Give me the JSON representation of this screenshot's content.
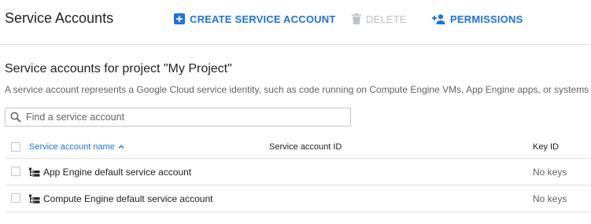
{
  "header": {
    "title": "Service Accounts",
    "create_label": "CREATE SERVICE ACCOUNT",
    "delete_label": "DELETE",
    "permissions_label": "PERMISSIONS"
  },
  "section": {
    "title": "Service accounts for project \"My Project\"",
    "description": "A service account represents a Google Cloud service identity, such as code running on Compute Engine VMs, App Engine apps, or systems"
  },
  "search": {
    "placeholder": "Find a service account",
    "value": ""
  },
  "table": {
    "columns": {
      "name": "Service account name",
      "id": "Service account ID",
      "key": "Key ID"
    },
    "sort": "ascending",
    "rows": [
      {
        "name": "App Engine default service account",
        "id": "",
        "key": "No keys"
      },
      {
        "name": "Compute Engine default service account",
        "id": "",
        "key": "No keys"
      }
    ]
  },
  "colors": {
    "accent": "#1a73e8",
    "disabled": "#bdc1c6",
    "divider": "#dadce0"
  },
  "icons": {
    "create": "add-box-icon",
    "delete": "trash-icon",
    "permissions": "person-add-icon",
    "search": "search-icon",
    "sort": "arrow-up-icon",
    "account": "service-account-icon"
  }
}
